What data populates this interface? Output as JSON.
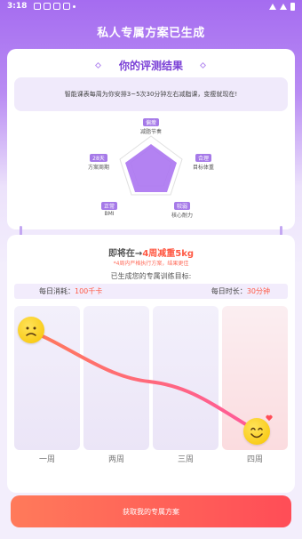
{
  "status_bar": {
    "time": "3:18"
  },
  "page_title": "私人专属方案已生成",
  "result_card": {
    "title": "你的评测结果",
    "advice": "智能课表每周为你安排3~5次30分钟左右减脂课，变瘦就现在!",
    "radar_axes": [
      {
        "value": "偏瘦",
        "label": "减脂节奏"
      },
      {
        "value": "合理",
        "label": "目标体重"
      },
      {
        "value": "较弱",
        "label": "核心耐力"
      },
      {
        "value": "正常",
        "label": "BMI"
      },
      {
        "value": "28天",
        "label": "方案周期"
      }
    ]
  },
  "plan_card": {
    "goal_prefix": "即将在→",
    "goal_highlight": "4周减重5kg",
    "goal_note": "*4周内严格执行方案，结果更佳",
    "generated_text": "已生成您的专属训练目标:",
    "daily_burn_label": "每日消耗：",
    "daily_burn_value": "100千卡",
    "daily_time_label": "每日时长：",
    "daily_time_value": "30分钟",
    "weeks": [
      "一周",
      "两周",
      "三周",
      "四周"
    ]
  },
  "colors": {
    "accent": "#a56cf0",
    "highlight": "#ff5a45",
    "cta": "#ff4d57"
  },
  "cta_label": "获取我的专属方案"
}
